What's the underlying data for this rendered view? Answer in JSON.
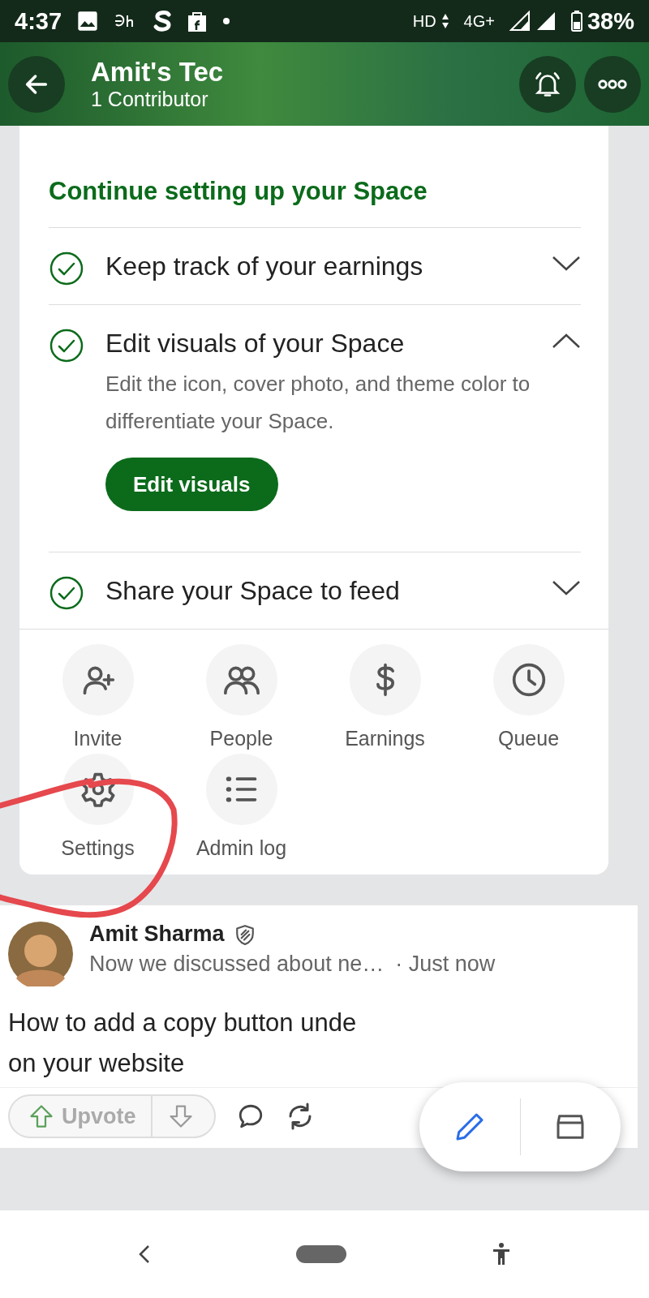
{
  "status_bar": {
    "time": "4:37",
    "network_labels": [
      "HD",
      "4G+"
    ],
    "battery": "38%"
  },
  "header": {
    "title": "Amit's Tec",
    "subtitle": "1 Contributor"
  },
  "setup_card": {
    "title": "Continue setting up your Space",
    "steps": [
      {
        "label": "Keep track of your earnings",
        "done": true,
        "expanded": false
      },
      {
        "label": "Edit visuals of your Space",
        "done": true,
        "expanded": true,
        "description": "Edit the icon, cover photo, and theme color to differentiate your Space.",
        "button": "Edit visuals"
      },
      {
        "label": "Share your Space to feed",
        "done": true,
        "expanded": false
      }
    ]
  },
  "actions": [
    {
      "label": "Invite",
      "kind": "invite"
    },
    {
      "label": "People",
      "kind": "people"
    },
    {
      "label": "Earnings",
      "kind": "earnings"
    },
    {
      "label": "Queue",
      "kind": "queue"
    },
    {
      "label": "Settings",
      "kind": "settings"
    },
    {
      "label": "Admin log",
      "kind": "log"
    }
  ],
  "post": {
    "author": "Amit Sharma",
    "meta": "Now we discussed about ne…",
    "time": "· Just now",
    "body_lines": [
      "How to add a copy button unde",
      "on your website"
    ],
    "upvote_label": "Upvote"
  }
}
